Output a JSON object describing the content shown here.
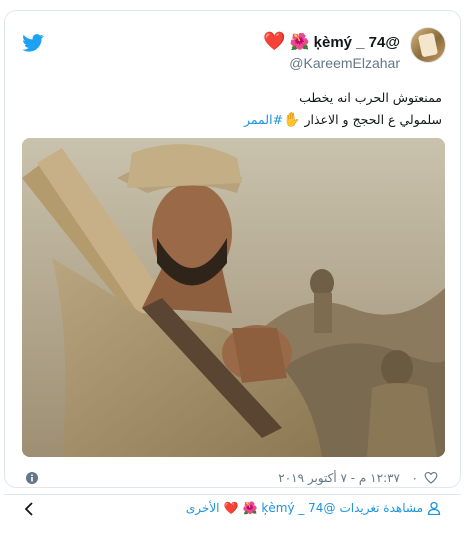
{
  "tweet": {
    "display_name": "ķèmý _ 74@",
    "handle": "@KareemElzahar",
    "emoji_heart": "❤️",
    "emoji_flower": "🌺",
    "text_line1": "ممنعتوش الحرب انه يخطب",
    "text_line2": "سلمولي ع الحجج و الاعذار ",
    "text_emoji": "✋",
    "hashtag": "#الممر",
    "like_count": "٠",
    "timestamp": "١٢:٣٧ م - ٧ أكتوبر ٢٠١٩"
  },
  "footer": {
    "link_text": "مشاهدة تغريدات ",
    "link_name": "ķèmý _ 74@",
    "link_suffix": " الأخرى",
    "link_emoji_heart": "❤️",
    "link_emoji_flower": "🌺"
  },
  "icons": {
    "bird": "twitter-bird-icon",
    "info": "info-icon",
    "like": "heart-outline-icon",
    "chevron": "chevron-left-icon",
    "person": "person-icon"
  },
  "colors": {
    "accent": "#1da1f2",
    "link": "#1b95e0",
    "muted": "#657786",
    "heart": "#e0245e",
    "border": "#e1e8ed"
  }
}
